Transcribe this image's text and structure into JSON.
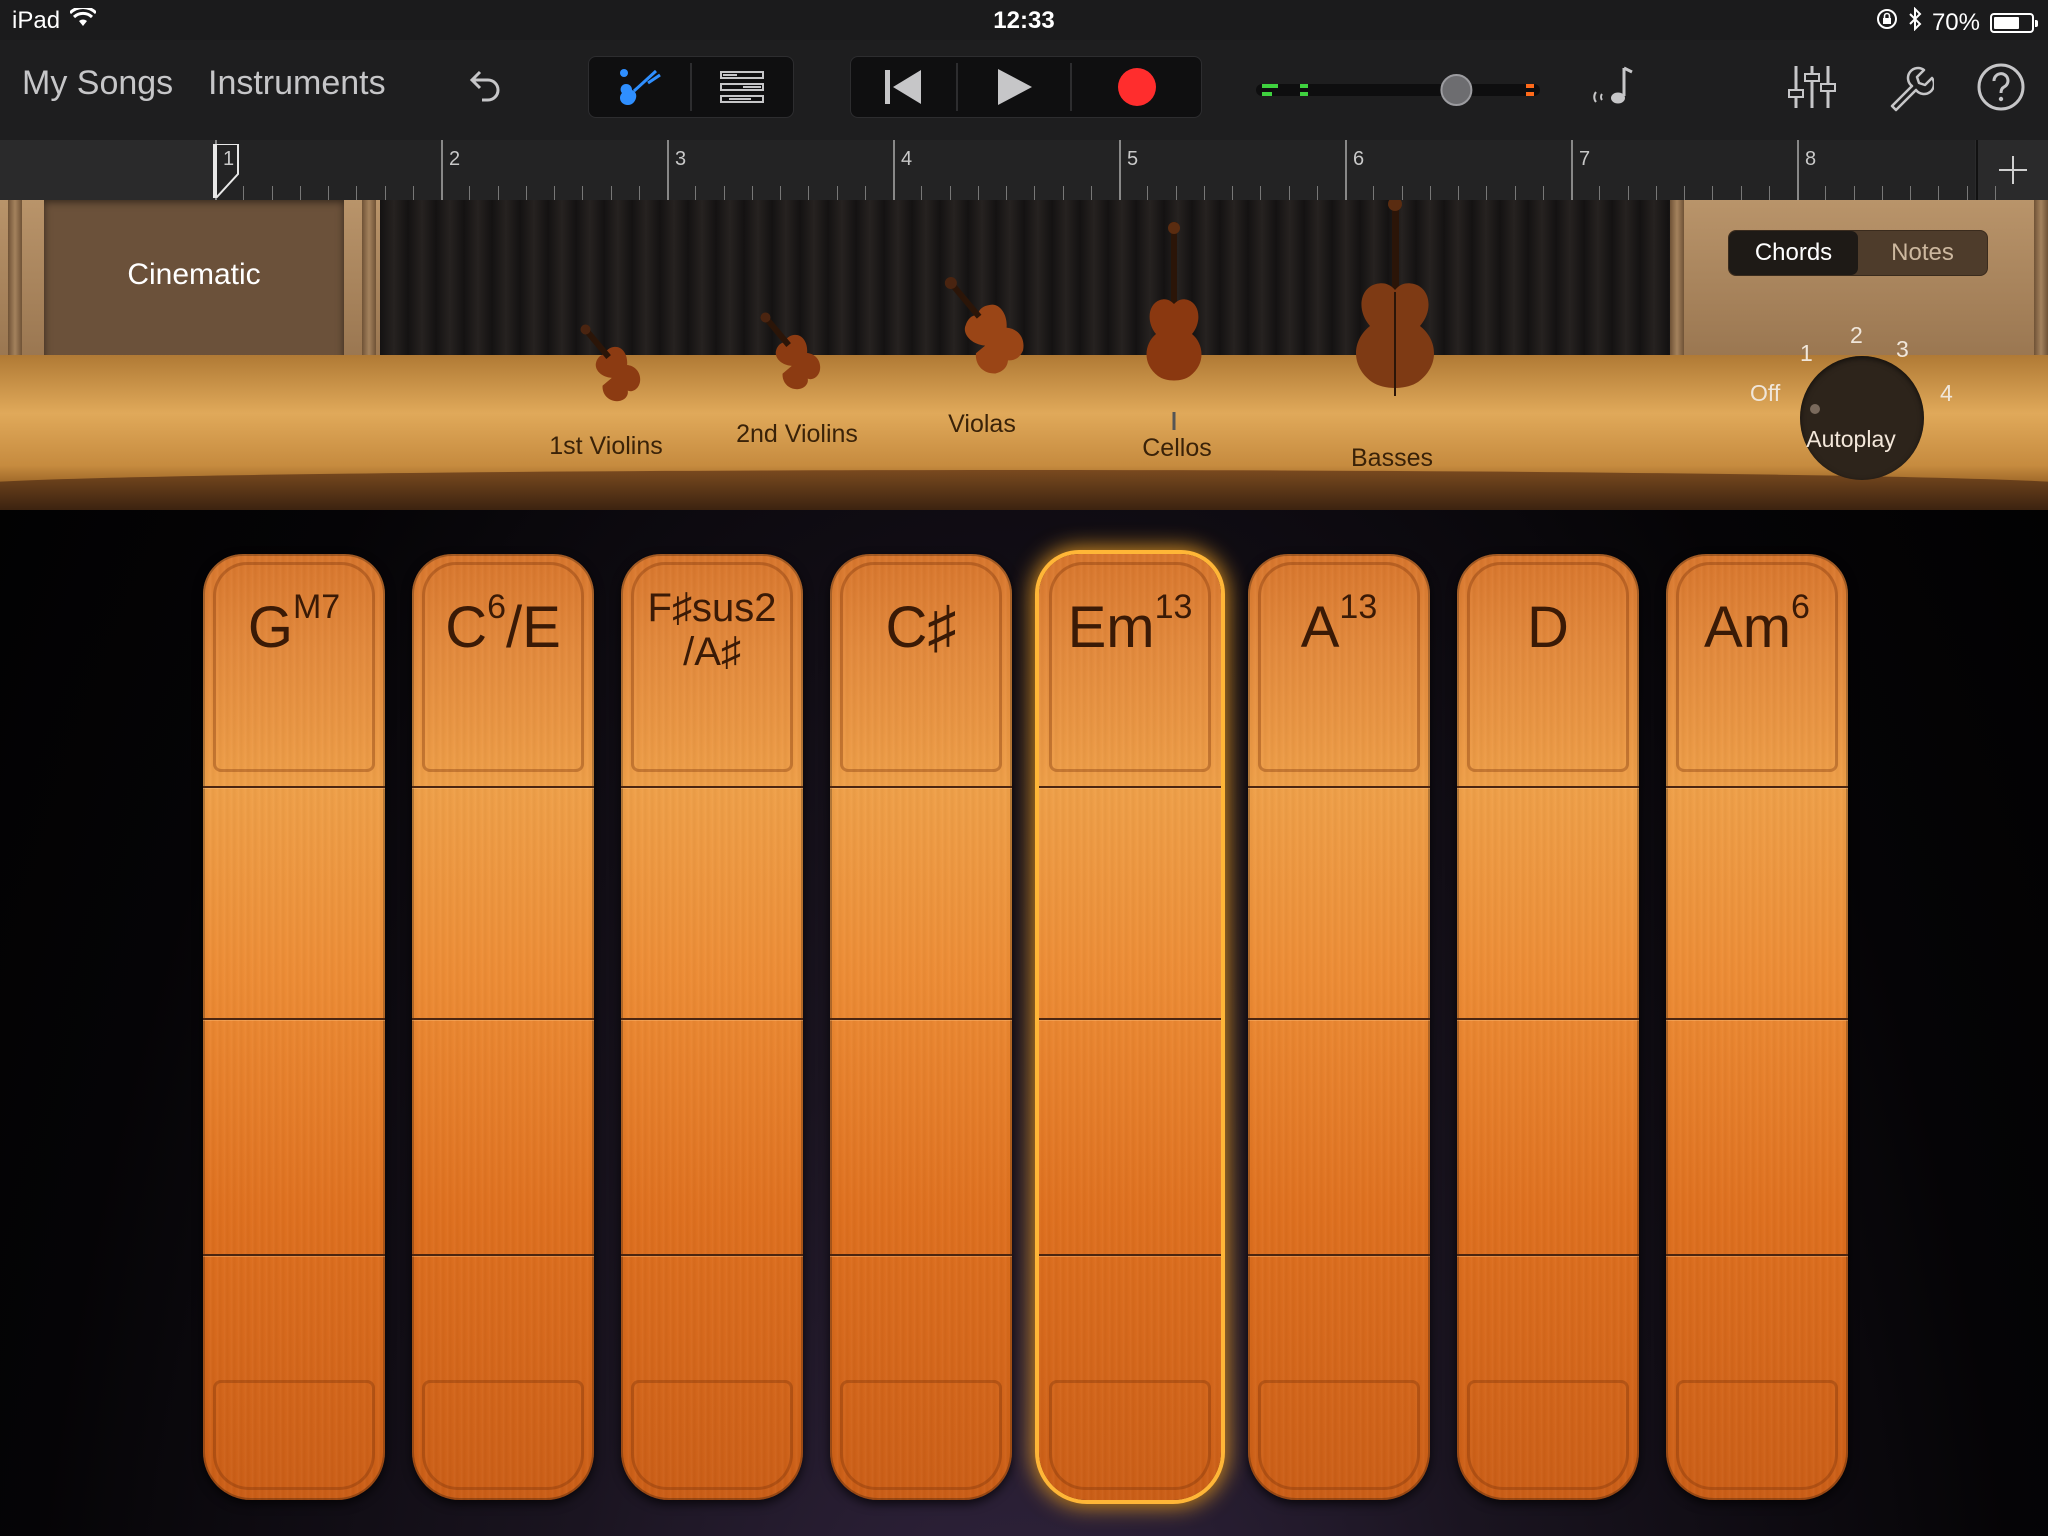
{
  "status_bar": {
    "device": "iPad",
    "time": "12:33",
    "battery_text": "70%",
    "battery_level": 0.7
  },
  "toolbar": {
    "my_songs": "My Songs",
    "instruments": "Instruments",
    "icons": [
      "undo-icon",
      "instrument-view-icon",
      "tracks-view-icon",
      "rewind-icon",
      "play-icon",
      "record-icon",
      "master-volume-slider",
      "metronome-icon",
      "mixer-icon",
      "settings-wrench-icon",
      "help-icon"
    ],
    "master_volume_level": 0.7
  },
  "ruler": {
    "bars": [
      "1",
      "2",
      "3",
      "4",
      "5",
      "6",
      "7",
      "8"
    ],
    "add_label": "+"
  },
  "stage": {
    "preset_name": "Cinematic",
    "instruments": [
      {
        "label": "1st Violins",
        "icon": "violin-icon"
      },
      {
        "label": "2nd Violins",
        "icon": "violin-icon"
      },
      {
        "label": "Violas",
        "icon": "viola-icon"
      },
      {
        "label": "Cellos",
        "icon": "cello-icon"
      },
      {
        "label": "Basses",
        "icon": "double-bass-icon"
      }
    ],
    "mode_toggle": {
      "chords": "Chords",
      "notes": "Notes",
      "selected": "Chords"
    },
    "autoplay": {
      "label": "Autoplay",
      "off": "Off",
      "positions": [
        "1",
        "2",
        "3",
        "4"
      ],
      "selected": "Off"
    }
  },
  "chords": [
    {
      "root": "G",
      "sup": "M7",
      "rest": ""
    },
    {
      "root": "C",
      "sup": "6",
      "rest": "/E"
    },
    {
      "root": "F♯sus2",
      "sup": "",
      "rest": "/A♯",
      "two_line": true
    },
    {
      "root": "C♯",
      "sup": "",
      "rest": ""
    },
    {
      "root": "Em",
      "sup": "13",
      "rest": "",
      "active": true
    },
    {
      "root": "A",
      "sup": "13",
      "rest": ""
    },
    {
      "root": "D",
      "sup": "",
      "rest": ""
    },
    {
      "root": "Am",
      "sup": "6",
      "rest": ""
    }
  ],
  "colors": {
    "accent_blue": "#2f8fff",
    "record_red": "#ff2d2d",
    "wood_orange": "#e88a36",
    "active_glow": "#ffb637"
  }
}
